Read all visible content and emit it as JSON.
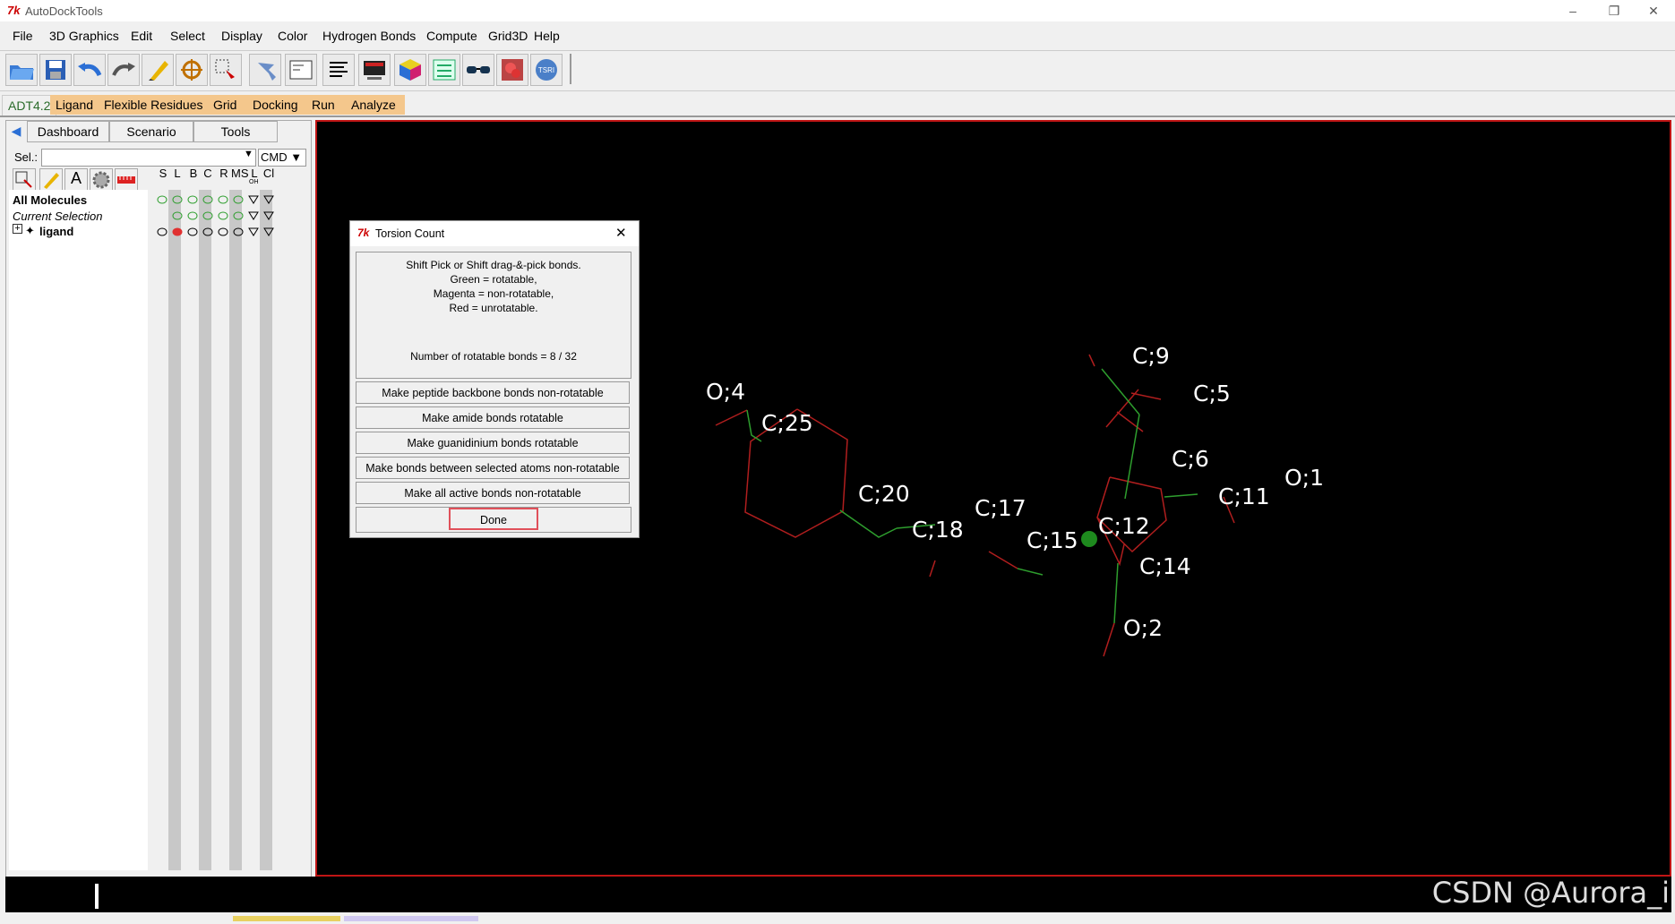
{
  "window": {
    "title": "AutoDockTools",
    "app_icon": "7k",
    "min": "–",
    "max": "❐",
    "close": "✕"
  },
  "menubar": [
    "File",
    "3D Graphics",
    "Edit",
    "Select",
    "Display",
    "Color",
    "Hydrogen Bonds",
    "Compute",
    "Grid3D",
    "Help"
  ],
  "toolbar": {
    "icons": [
      "open-folder-icon",
      "save-icon",
      "undo-icon",
      "redo-icon",
      "pencil-icon",
      "crosshair-icon",
      "pick-icon",
      "hand-icon",
      "python-shell-icon",
      "text-list-icon",
      "monitor-icon",
      "color-cube-icon",
      "dashboard-icon",
      "stereo-glasses-icon",
      "molecule-3d-icon",
      "pmv-logo-icon"
    ]
  },
  "adt_menu": {
    "version": "ADT4.2",
    "items": [
      "Ligand",
      "Flexible Residues",
      "Grid",
      "Docking",
      "Run",
      "Analyze"
    ]
  },
  "left_panel": {
    "tabs": [
      "Dashboard",
      "Scenario",
      "Tools"
    ],
    "sel_label": "Sel.:",
    "cmd_label": "CMD",
    "column_headers": [
      "S",
      "L",
      "B",
      "C",
      "R",
      "MS",
      "L",
      "Cl"
    ],
    "column_subheaders": [
      "",
      "",
      "",
      "",
      "",
      "",
      "OH",
      ""
    ],
    "rows": [
      {
        "label": "All Molecules",
        "style": "bold"
      },
      {
        "label": "Current Selection",
        "style": "italic"
      },
      {
        "label": "ligand",
        "style": "bold",
        "expander": "+"
      }
    ]
  },
  "viewer": {
    "atom_labels": [
      "O;4",
      "C;25",
      "C;20",
      "C;18",
      "C;17",
      "C;15",
      "C;12",
      "C;9",
      "C;5",
      "C;6",
      "C;11",
      "O;1",
      "C;14",
      "O;2"
    ]
  },
  "dialog": {
    "title": "Torsion Count",
    "instructions": [
      "Shift Pick or Shift drag-&-pick bonds.",
      "Green = rotatable,",
      "Magenta = non-rotatable,",
      "Red = unrotatable."
    ],
    "count_text": "Number of rotatable bonds = 8 / 32",
    "buttons": [
      "Make peptide backbone bonds non-rotatable",
      "Make amide bonds rotatable",
      "Make guanidinium bonds rotatable",
      "Make bonds between selected atoms non-rotatable",
      "Make all active bonds non-rotatable"
    ],
    "done_label": "Done",
    "close_glyph": "✕"
  },
  "watermark": "CSDN @Aurora_i",
  "colors": {
    "rotatable": "#2e9e2e",
    "unrotatable": "#b01e1e",
    "viewer_border": "#c01515",
    "adt_menu_bg": "#f4c78c"
  }
}
